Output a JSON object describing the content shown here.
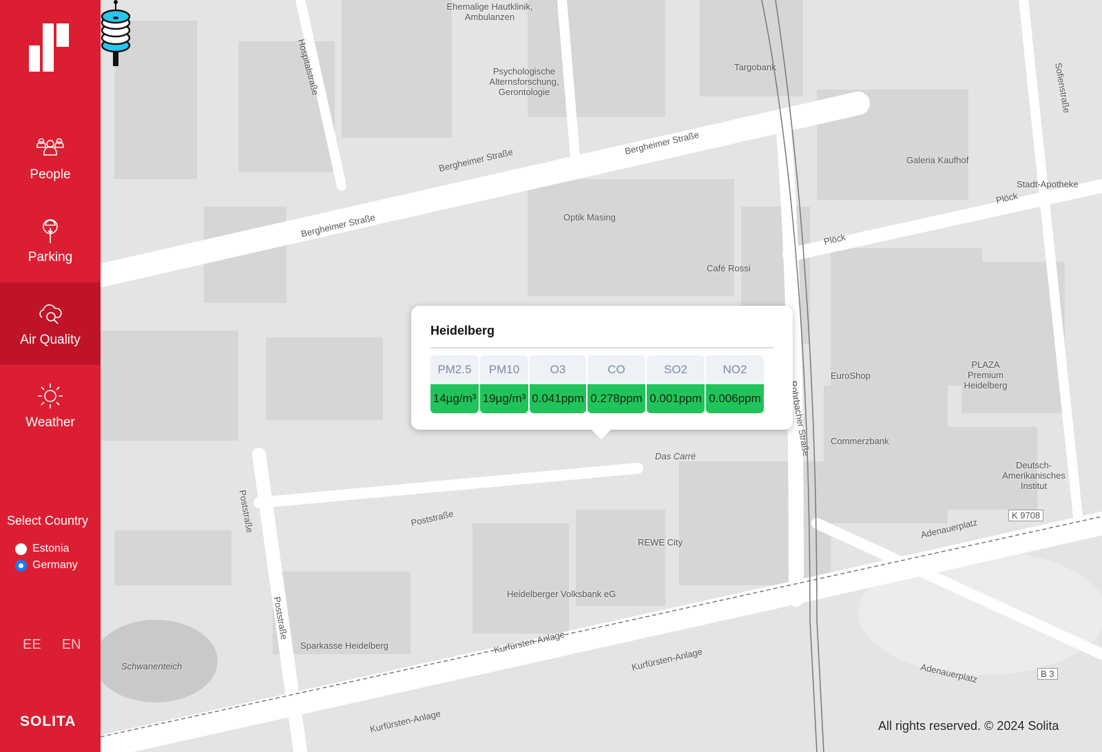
{
  "sidebar": {
    "nav": [
      {
        "label": "People",
        "icon": "people-icon"
      },
      {
        "label": "Parking",
        "icon": "parking-meter-icon"
      },
      {
        "label": "Air Quality",
        "icon": "cloud-search-icon",
        "active": true
      },
      {
        "label": "Weather",
        "icon": "sun-icon"
      }
    ],
    "select_country": "Select Country",
    "countries": [
      {
        "label": "Estonia",
        "selected": false
      },
      {
        "label": "Germany",
        "selected": true
      }
    ],
    "languages": [
      "EE",
      "EN"
    ],
    "brand": "SOLITA"
  },
  "map": {
    "labels": [
      "Bergheimer Straße",
      "Bergheimer Straße",
      "Bergheimer Straße",
      "Poststraße",
      "Poststraße",
      "Poststraße",
      "Kurfürsten-Anlage",
      "Kurfürsten-Anlage",
      "Kurfürsten-Anlage",
      "Rohrbacher Straße",
      "Adenauerplatz",
      "Adenauerplatz",
      "Plöck",
      "Plöck",
      "Sofienstraße",
      "Hospitalstraße",
      "Galeria Kaufhof",
      "Das Carré",
      "Sparkasse Heidelberg",
      "Heidelberger Volksbank eG",
      "Schwanenteich",
      "REWE City",
      "Optik Masing",
      "Café Rossi",
      "EuroShop",
      "Commerzbank",
      "Targobank",
      "Psychologische Alternsforschung, Gerontologie",
      "Ehemalige Hautklinik, Ambulanzen",
      "PLAZA Premium Heidelberg",
      "Deutsch-Amerikanisches Institut",
      "Stadt-Apotheke",
      "K 9708",
      "B 3"
    ],
    "popup": {
      "title": "Heidelberg",
      "headers": [
        "PM2.5",
        "PM10",
        "O3",
        "CO",
        "SO2",
        "NO2"
      ],
      "values": [
        "14µg/m³",
        "19µg/m³",
        "0.041ppm",
        "0.278ppm",
        "0.001ppm",
        "0.006ppm"
      ],
      "status_color": "#22c35a"
    },
    "zoom_in": "+",
    "zoom_out": "−",
    "copyright": "All rights reserved. © 2024 Solita"
  },
  "colors": {
    "brand": "#dc1e32",
    "active": "#bf1428"
  }
}
